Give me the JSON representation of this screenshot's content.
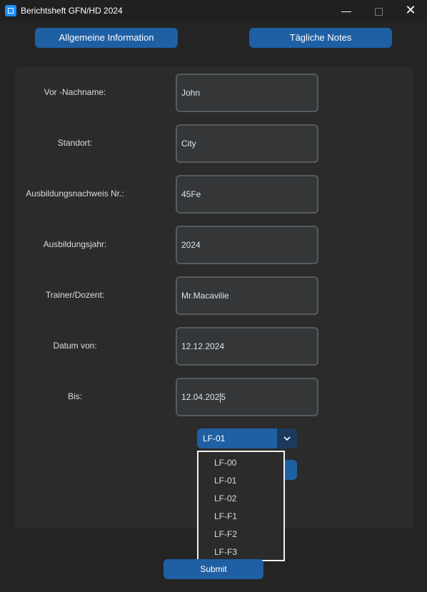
{
  "window": {
    "title": "Berichtsheft GFN/HD 2024",
    "minimize_glyph": "—",
    "close_glyph": "✕"
  },
  "tabs": {
    "left_label": "Allgemeine Information",
    "right_label": "Tägliche Notes"
  },
  "form": {
    "fields": [
      {
        "label": "Vor -Nachname:",
        "value": "John"
      },
      {
        "label": "Standort:",
        "value": "City"
      },
      {
        "label": "Ausbildungsnachweis Nr.:",
        "value": "45Fe"
      },
      {
        "label": "Ausbildungsjahr:",
        "value": "2024"
      },
      {
        "label": "Trainer/Dozent:",
        "value": "Mr.Macavilie"
      },
      {
        "label": "Datum von:",
        "value": "12.12.2024"
      },
      {
        "label": "Bis:",
        "value_before_caret": "12.04.202",
        "value_after_caret": "5"
      }
    ]
  },
  "combo": {
    "selected": "LF-01",
    "options": [
      "LF-00",
      "LF-01",
      "LF-02",
      "LF-F1",
      "LF-F2",
      "LF-F3"
    ]
  },
  "submit_label": "Submit",
  "colors": {
    "accent": "#1f5fa3",
    "background": "#242424",
    "panel": "#2b2b2b",
    "entry": "#343638"
  }
}
